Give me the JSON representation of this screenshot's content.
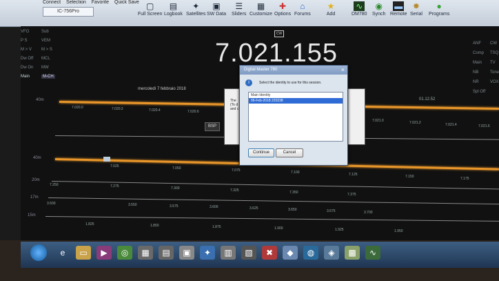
{
  "quick_access": [
    "Connect",
    "Selection",
    "Favorite",
    "Quick Save"
  ],
  "radio_tab": "IC-756Pro",
  "ribbon": [
    "Full Screen",
    "Logbook",
    "Satellites",
    "SW Data",
    "Sliders",
    "Customize",
    "Options",
    "Forums",
    "Add",
    "DM780",
    "Synch",
    "Remote",
    "Serial",
    "Programs"
  ],
  "left_panel": [
    [
      "VFO",
      "Sub"
    ],
    [
      "P S",
      "VEM"
    ],
    [
      "M > V",
      "M > S"
    ],
    [
      "Dw Off",
      "MCL"
    ],
    [
      "Dw On",
      "MW"
    ],
    [
      "Main",
      "M-CH"
    ]
  ],
  "right_panel": [
    "ANF",
    "Comp",
    "Main",
    "NB",
    "NR",
    "Spl Off"
  ],
  "right_panel_b": [
    "CW",
    "TSQ",
    "TV",
    "Tone",
    "VOX"
  ],
  "frequency": "7.021.155",
  "mode": "CW",
  "date": "mercoledì 7 febbraio 2018",
  "time": "01.12.52",
  "bsp": "BSP",
  "band_labels": [
    "40m",
    "40m",
    "20m",
    "17m",
    "15m"
  ],
  "band1_ticks": [
    "7.020.0",
    "7.020.2",
    "7.020.4",
    "7.020.6",
    "7.021.0",
    "7.021.2",
    "7.021.4",
    "7.021.6"
  ],
  "band2_ticks": [
    "7.025",
    "7.050",
    "7.075",
    "7.100",
    "7.125",
    "7.150",
    "7.175"
  ],
  "band3_ticks": [
    "7.250",
    "7.275",
    "7.300",
    "7.325",
    "7.350",
    "7.375"
  ],
  "band4_ticks": [
    "3.500",
    "3.550",
    "3.575",
    "3.600",
    "3.625",
    "3.650",
    "3.675",
    "3.700"
  ],
  "band5_ticks": [
    "1.825",
    "1.850",
    "1.875",
    "1.900",
    "1.925",
    "1.950"
  ],
  "back_dialog_text": [
    "The",
    "(To d",
    "and c"
  ],
  "dialog": {
    "title": "Digital Master 780",
    "message": "Select the identity to use for this session.",
    "list_header": "Main Identity",
    "list_item": "06-Feb-2018 220238",
    "continue": "Continue",
    "cancel": "Cancel"
  }
}
